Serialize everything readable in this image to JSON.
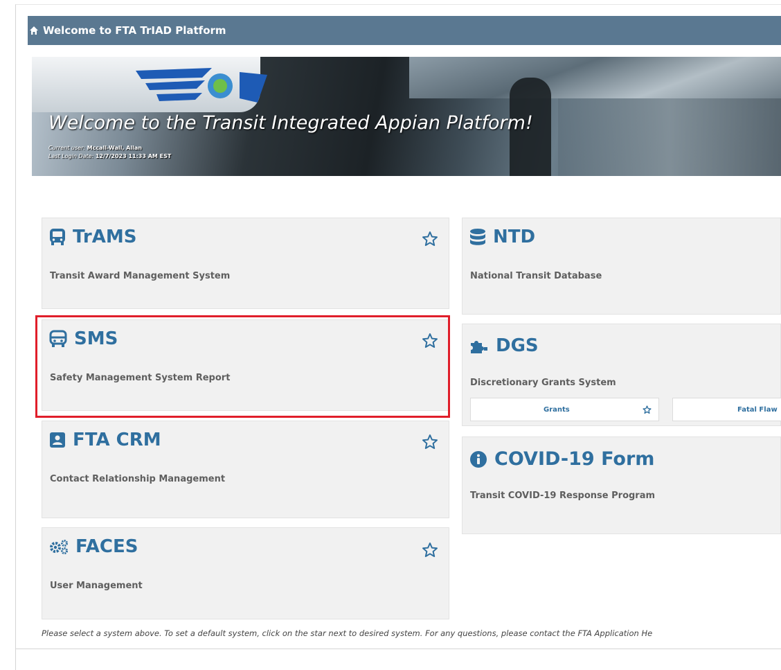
{
  "window": {
    "title": "Welcome to FTA TrIAD Platform"
  },
  "banner": {
    "headline": "Welcome to the Transit Integrated Appian Platform!",
    "user_label": "Current user:",
    "user_value": "Mccall-Wall, Allan",
    "login_label": "Last Login Date:",
    "login_value": "12/7/2023 11:33 AM EST"
  },
  "systems": {
    "trams": {
      "name": "TrAMS",
      "desc": "Transit Award Management System",
      "icon": "bus-front-icon"
    },
    "sms": {
      "name": "SMS",
      "desc": "Safety Management System Report",
      "icon": "bus-icon"
    },
    "crm": {
      "name": "FTA CRM",
      "desc": "Contact Relationship Management",
      "icon": "contact-card-icon"
    },
    "faces": {
      "name": "FACES",
      "desc": "User Management",
      "icon": "gears-icon"
    },
    "ntd": {
      "name": "NTD",
      "desc": "National Transit Database",
      "icon": "database-icon"
    },
    "dgs": {
      "name": "DGS",
      "desc": "Discretionary Grants System",
      "icon": "puzzle-icon",
      "sub_links": [
        {
          "label": "Grants"
        },
        {
          "label": "Fatal Flaw"
        }
      ]
    },
    "covid": {
      "name": "COVID-19 Form",
      "desc": "Transit COVID-19 Response Program",
      "icon": "info-circle-icon"
    }
  },
  "footer": {
    "text": "Please select a system above. To set a default system, click on the star next to desired system. For any questions, please contact the FTA Application He"
  },
  "colors": {
    "title_bar": "#5a7891",
    "card_bg": "#f1f1f1",
    "accent_blue": "#2f6f9f",
    "highlight_red": "#e01e2a"
  }
}
